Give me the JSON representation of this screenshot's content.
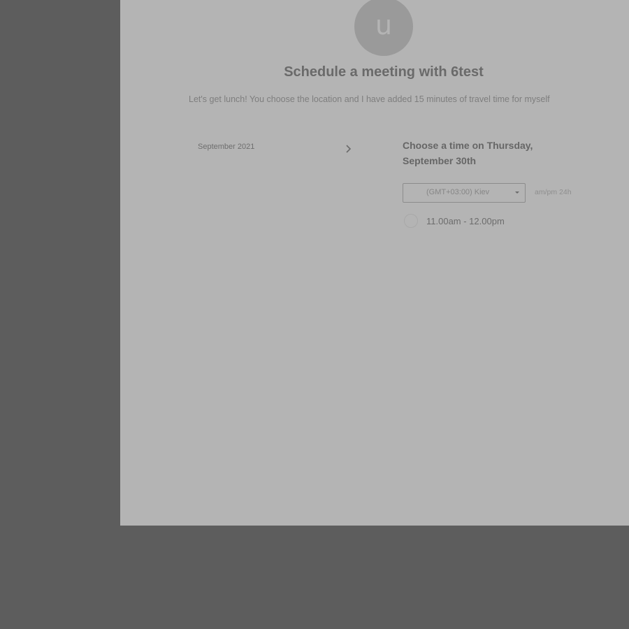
{
  "avatar": {
    "letter": "u"
  },
  "header": {
    "title": "Schedule a meeting with 6test",
    "subtitle": "Let's get lunch! You choose the location and I have added 15 minutes of travel time for myself"
  },
  "calendar": {
    "month_label": "September 2021",
    "next_icon": "chevron-right-icon"
  },
  "times": {
    "heading": "Choose a time on Thursday, September 30th",
    "timezone": "(GMT+03:00) Kiev",
    "format_ampm": "am/pm",
    "format_24h": "24h",
    "slots": [
      {
        "label": "11.00am - 12.00pm"
      }
    ]
  },
  "colors": {
    "backdrop": "#5d5d5d",
    "panel": "#b4b4b4"
  }
}
